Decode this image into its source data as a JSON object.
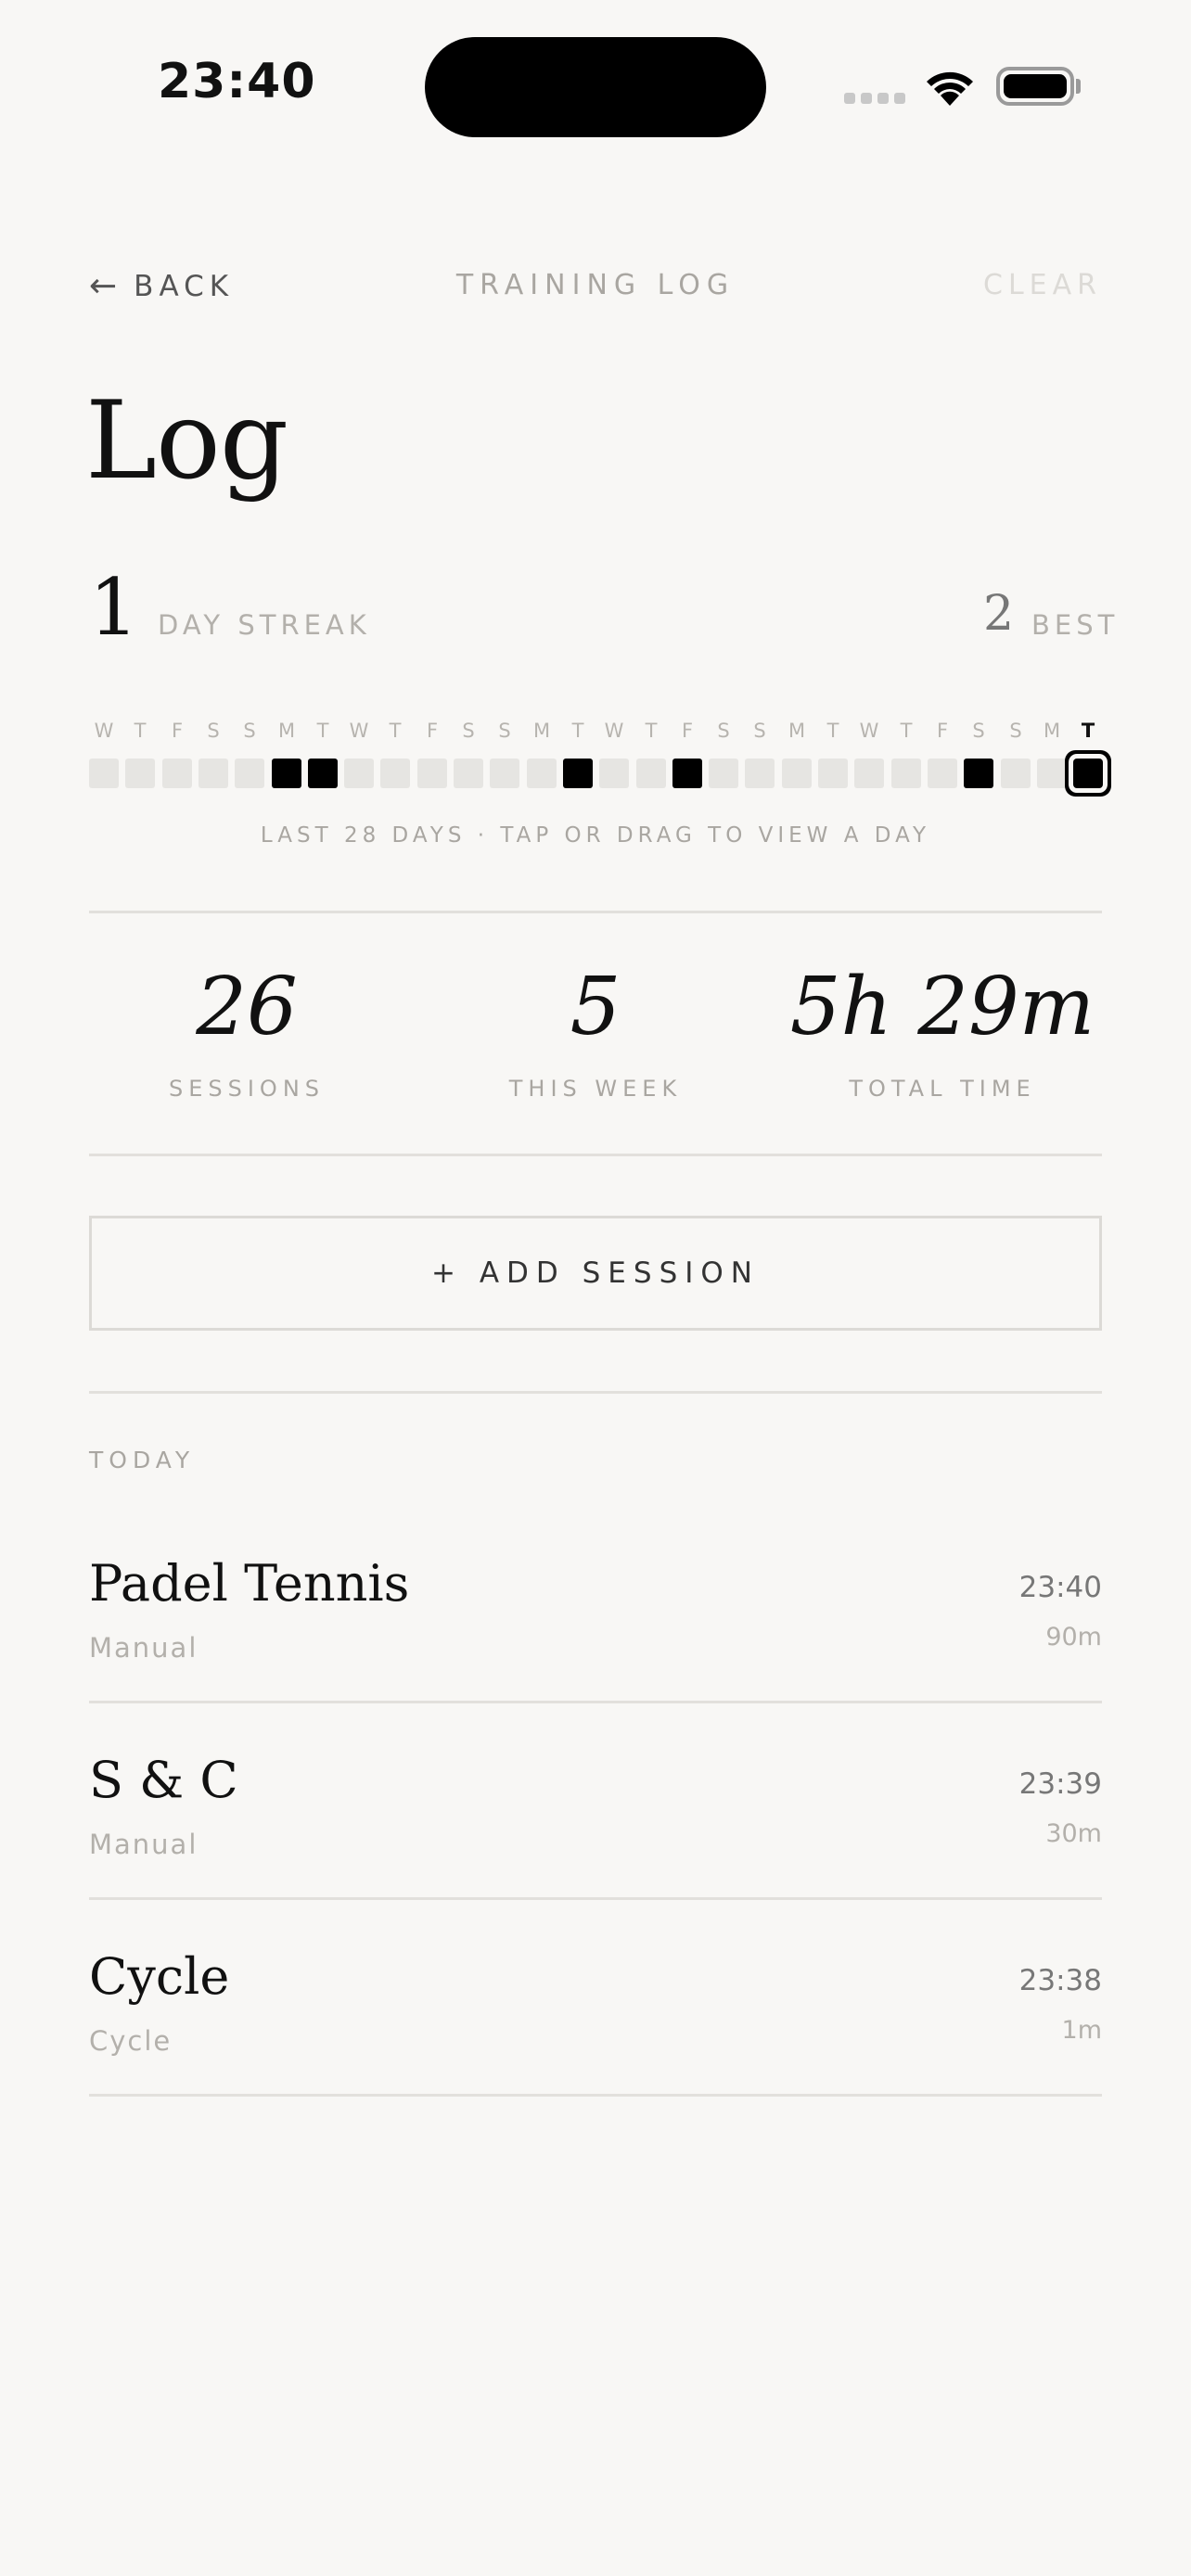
{
  "status_bar": {
    "time": "23:40",
    "icons": [
      "signal-icon",
      "wifi-icon",
      "battery-icon"
    ]
  },
  "nav": {
    "back_arrow": "←",
    "back_label": "BACK",
    "title": "TRAINING LOG",
    "clear_label": "CLEAR"
  },
  "page": {
    "title": "Log"
  },
  "streak": {
    "current": "1",
    "current_label": "DAY STREAK",
    "best": "2",
    "best_label": "BEST"
  },
  "calendar": {
    "days": [
      {
        "letter": "W",
        "active": false
      },
      {
        "letter": "T",
        "active": false
      },
      {
        "letter": "F",
        "active": false
      },
      {
        "letter": "S",
        "active": false
      },
      {
        "letter": "S",
        "active": false
      },
      {
        "letter": "M",
        "active": true
      },
      {
        "letter": "T",
        "active": true
      },
      {
        "letter": "W",
        "active": false
      },
      {
        "letter": "T",
        "active": false
      },
      {
        "letter": "F",
        "active": false
      },
      {
        "letter": "S",
        "active": false
      },
      {
        "letter": "S",
        "active": false
      },
      {
        "letter": "M",
        "active": false
      },
      {
        "letter": "T",
        "active": true
      },
      {
        "letter": "W",
        "active": false
      },
      {
        "letter": "T",
        "active": false
      },
      {
        "letter": "F",
        "active": true
      },
      {
        "letter": "S",
        "active": false
      },
      {
        "letter": "S",
        "active": false
      },
      {
        "letter": "M",
        "active": false
      },
      {
        "letter": "T",
        "active": false
      },
      {
        "letter": "W",
        "active": false
      },
      {
        "letter": "T",
        "active": false
      },
      {
        "letter": "F",
        "active": false
      },
      {
        "letter": "S",
        "active": true
      },
      {
        "letter": "S",
        "active": false
      },
      {
        "letter": "M",
        "active": false
      },
      {
        "letter": "T",
        "active": true,
        "today": true
      }
    ],
    "caption": "LAST 28 DAYS · TAP OR DRAG TO VIEW A DAY"
  },
  "stats": [
    {
      "value": "26",
      "label": "SESSIONS"
    },
    {
      "value": "5",
      "label": "THIS WEEK"
    },
    {
      "value": "5h 29m",
      "label": "TOTAL TIME"
    }
  ],
  "add_session_label": "+ ADD SESSION",
  "today_section": {
    "label": "TODAY",
    "sessions": [
      {
        "name": "Padel Tennis",
        "source": "Manual",
        "time": "23:40",
        "duration": "90m"
      },
      {
        "name": "S & C",
        "source": "Manual",
        "time": "23:39",
        "duration": "30m"
      },
      {
        "name": "Cycle",
        "source": "Cycle",
        "time": "23:38",
        "duration": "1m"
      }
    ]
  },
  "colors": {
    "background": "#f8f7f5",
    "active_day": "#000000",
    "inactive_day": "#e6e5e2",
    "muted_text": "#a9a6a1"
  }
}
